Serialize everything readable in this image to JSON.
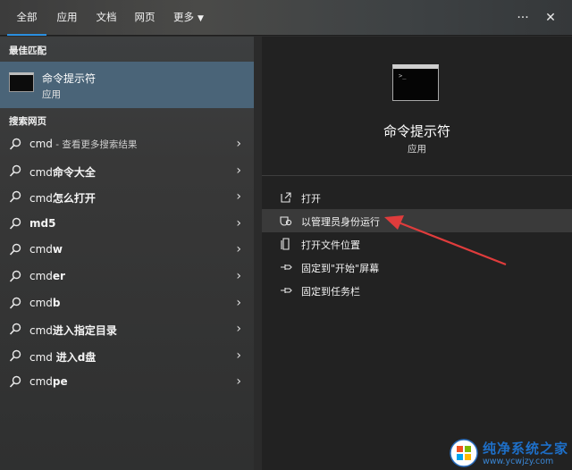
{
  "tabs": [
    {
      "label": "全部",
      "active": true
    },
    {
      "label": "应用"
    },
    {
      "label": "文档"
    },
    {
      "label": "网页"
    },
    {
      "label": "更多"
    }
  ],
  "top_icons": {
    "more": "···",
    "close": "✕"
  },
  "best_match": {
    "section": "最佳匹配",
    "name": "命令提示符",
    "type": "应用"
  },
  "web_section": "搜索网页",
  "web_results": [
    {
      "prefix": "cmd",
      "bold": "",
      "hint": " - 查看更多搜索结果"
    },
    {
      "prefix": "cmd",
      "bold": "命令大全",
      "hint": ""
    },
    {
      "prefix": "cmd",
      "bold": "怎么打开",
      "hint": ""
    },
    {
      "prefix": "",
      "bold": "md5",
      "hint": ""
    },
    {
      "prefix": "cmd",
      "bold": "w",
      "hint": ""
    },
    {
      "prefix": "cmd",
      "bold": "er",
      "hint": ""
    },
    {
      "prefix": "cmd",
      "bold": "b",
      "hint": ""
    },
    {
      "prefix": "cmd",
      "bold": "进入指定目录",
      "hint": ""
    },
    {
      "prefix": "cmd ",
      "bold": "进入d盘",
      "hint": ""
    },
    {
      "prefix": "cmd",
      "bold": "pe",
      "hint": ""
    }
  ],
  "detail": {
    "title": "命令提示符",
    "type": "应用",
    "actions": [
      {
        "label": "打开",
        "icon": "open-icon"
      },
      {
        "label": "以管理员身份运行",
        "icon": "shield-icon"
      },
      {
        "label": "打开文件位置",
        "icon": "file-location-icon"
      },
      {
        "label": "固定到\"开始\"屏幕",
        "icon": "pin-icon"
      },
      {
        "label": "固定到任务栏",
        "icon": "pin-icon"
      }
    ]
  },
  "watermark": {
    "name": "纯净系统之家",
    "url": "www.ycwjzy.com"
  },
  "colors": {
    "accent": "#2a8fe0",
    "selected": "#4a6478",
    "arrow": "#e03c3c"
  }
}
